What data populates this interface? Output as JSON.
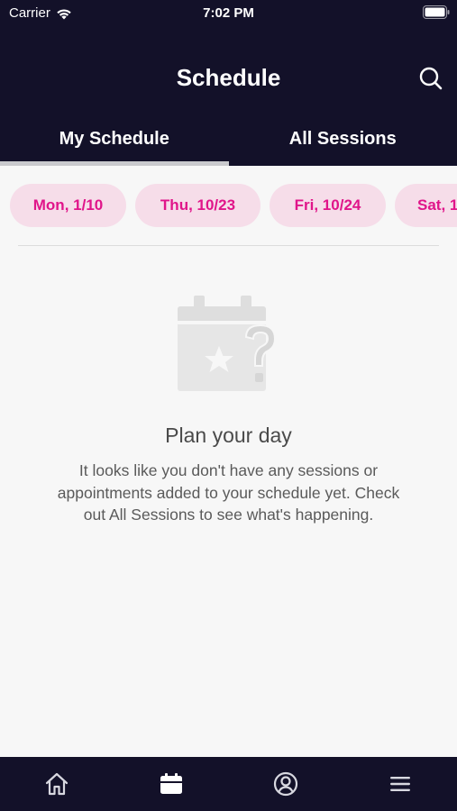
{
  "status_bar": {
    "carrier": "Carrier",
    "time": "7:02 PM"
  },
  "header": {
    "title": "Schedule",
    "search_icon": "search-icon"
  },
  "tabs": [
    {
      "label": "My Schedule",
      "active": true
    },
    {
      "label": "All Sessions",
      "active": false
    }
  ],
  "dates": [
    {
      "label": "Mon, 1/10"
    },
    {
      "label": "Thu, 10/23"
    },
    {
      "label": "Fri, 10/24"
    },
    {
      "label": "Sat, 1"
    }
  ],
  "empty_state": {
    "title": "Plan your day",
    "body": "It looks like you don't have any sessions or appointments added to your schedule yet. Check out All Sessions to see what's happening.",
    "icon": "calendar-question-icon"
  },
  "tab_bar": [
    {
      "icon": "home-icon"
    },
    {
      "icon": "calendar-icon",
      "active": true
    },
    {
      "icon": "profile-icon"
    },
    {
      "icon": "menu-icon"
    }
  ],
  "colors": {
    "nav_bg": "#131129",
    "accent": "#e0158a",
    "chip_bg": "#f6dde9",
    "page_bg": "#f7f7f7"
  }
}
